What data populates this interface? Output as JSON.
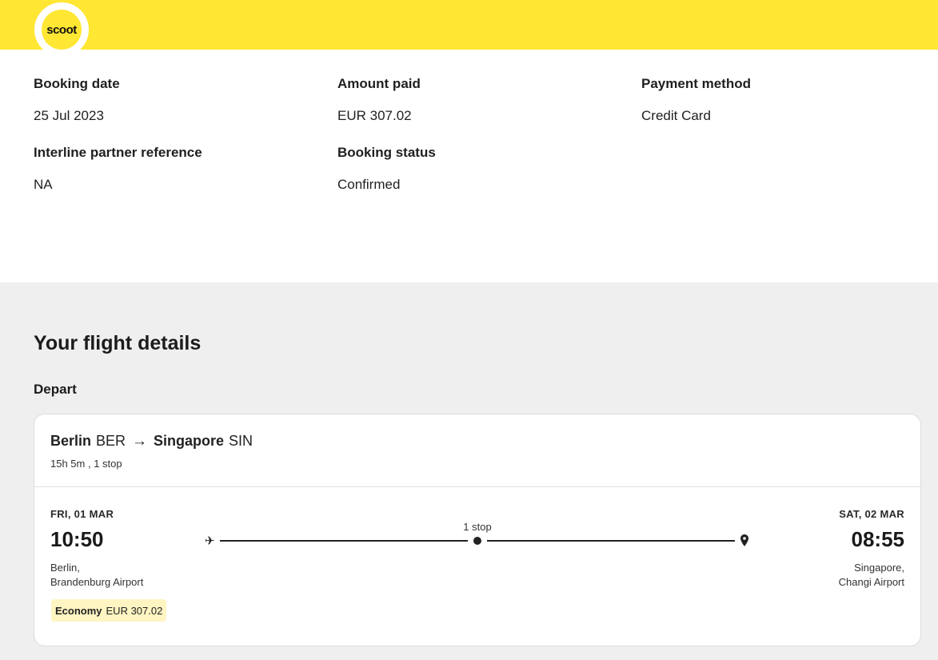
{
  "brand": {
    "logo_text": "scoot",
    "accent": "#ffe733"
  },
  "booking": {
    "booking_date_label": "Booking date",
    "booking_date": "25 Jul 2023",
    "amount_paid_label": "Amount paid",
    "amount_paid": "EUR 307.02",
    "payment_method_label": "Payment method",
    "payment_method": "Credit Card",
    "interline_label": "Interline partner reference",
    "interline_value": "NA",
    "status_label": "Booking status",
    "status_value": "Confirmed"
  },
  "flight": {
    "section_title": "Your flight details",
    "depart_label": "Depart",
    "origin_city": "Berlin",
    "origin_code": "BER",
    "arrow": "→",
    "dest_city": "Singapore",
    "dest_code": "SIN",
    "duration_stops": "15h 5m , 1 stop",
    "departure": {
      "date": "FRI, 01 MAR",
      "time": "10:50",
      "city_line1": "Berlin,",
      "city_line2": "Brandenburg Airport"
    },
    "arrival": {
      "date": "SAT, 02 MAR",
      "time": "08:55",
      "city_line1": "Singapore,",
      "city_line2": "Changi Airport"
    },
    "stop_text": "1 stop",
    "fare_class": "Economy",
    "fare_price": "EUR 307.02"
  },
  "icons": {
    "plane_glyph": "✈",
    "plane_icon": "plane-icon",
    "stop_icon": "stop-dot-icon",
    "destination_icon": "location-pin-icon"
  }
}
